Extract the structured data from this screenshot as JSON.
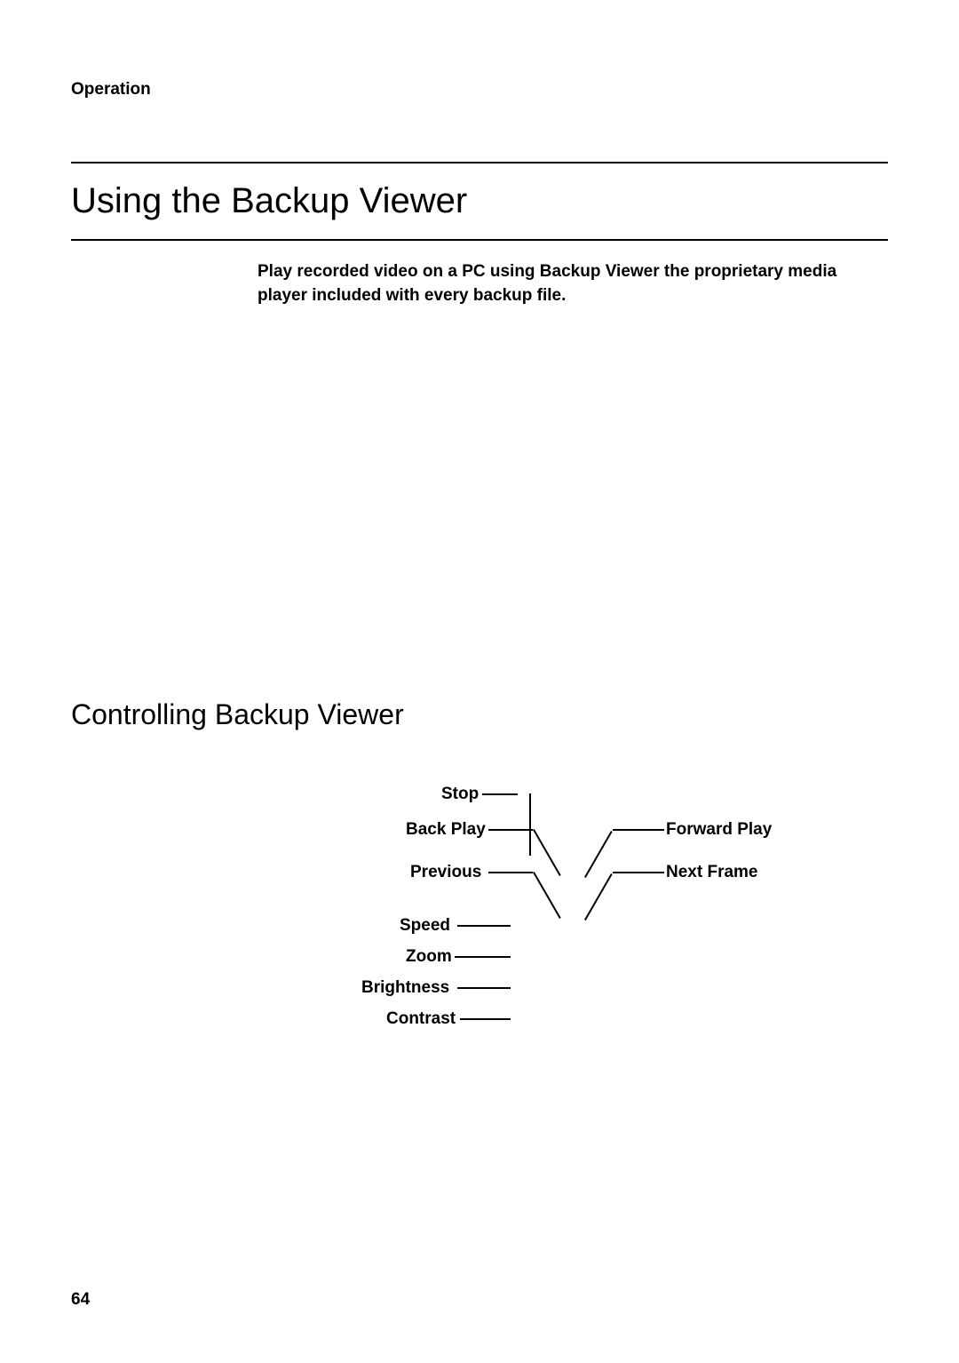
{
  "header": {
    "section": "Operation"
  },
  "title": "Using the Backup Viewer",
  "description": "Play recorded video on a PC using Backup Viewer the proprietary media player included with every backup file.",
  "subtitle": "Controlling Backup Viewer",
  "labels": {
    "stop": "Stop",
    "back_play": "Back Play",
    "previous": "Previous",
    "speed": "Speed",
    "zoom": "Zoom",
    "brightness": "Brightness",
    "contrast": "Contrast",
    "forward_play": "Forward Play",
    "next_frame": "Next Frame"
  },
  "page_number": "64"
}
